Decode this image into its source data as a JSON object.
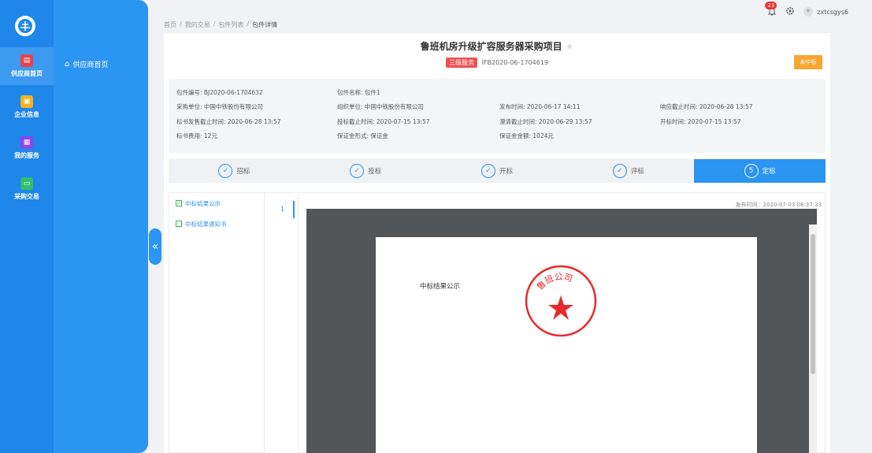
{
  "rail": {
    "items": [
      {
        "label": "供应商首页",
        "color": "#e8434a"
      },
      {
        "label": "企业信息",
        "color": "#f5b21c"
      },
      {
        "label": "我的服务",
        "color": "#8e44ef"
      },
      {
        "label": "采购交易",
        "color": "#2fbf71"
      }
    ]
  },
  "sidebar": {
    "item": "供应商首页",
    "collapse_glyph": "«"
  },
  "breadcrumb": [
    "首页",
    "我的交易",
    "包件列表",
    "包件详情"
  ],
  "breadcrumb_sep": "/",
  "topbar": {
    "notification_count": "23",
    "username": "zxtcsgys6"
  },
  "project": {
    "title": "鲁班机房升级扩容服务器采购项目",
    "service_tag": "三级服务",
    "code": "IFB2020-06-1704619",
    "status": "未中标"
  },
  "info": {
    "package_no": "包件编号: BJ2020-06-1704632",
    "package_name": "包件名称: 包件1",
    "buyer": "采购单位: 中国中铁股份有限公司",
    "organizer": "组织单位: 中国中铁股份有限公司",
    "publish_time": "发布时间: 2020-06-17 14:11",
    "answer_deadline": "响应截止时间: 2020-06-28 13:57",
    "doc_sale_deadline": "标书发售截止时间: 2020-06-28 13:57",
    "bid_deadline": "投标截止时间: 2020-07-15 13:57",
    "clarify_deadline": "澄清截止时间: 2020-06-29 13:57",
    "open_time": "开标时间: 2020-07-15 13:57",
    "doc_fee": "标书费用: 12元",
    "deposit_form": "保证金形式: 保证金",
    "deposit_amount": "保证金金额: 1024元"
  },
  "steps": [
    {
      "label": "招标",
      "mark": "✓"
    },
    {
      "label": "投标",
      "mark": "✓"
    },
    {
      "label": "开标",
      "mark": "✓"
    },
    {
      "label": "评标",
      "mark": "✓"
    },
    {
      "label": "定标",
      "mark": "5"
    }
  ],
  "docs": [
    {
      "label": "中标结果公示",
      "checked": "✓"
    },
    {
      "label": "中标结果通知书",
      "checked": ""
    }
  ],
  "viewer": {
    "page_number": "1",
    "publish_time": "发布时间：2020-07-03 08:37:33",
    "doc_title": "中标结果公示",
    "seal_text": "鲁班公司",
    "seal_color": "#e8282b"
  }
}
